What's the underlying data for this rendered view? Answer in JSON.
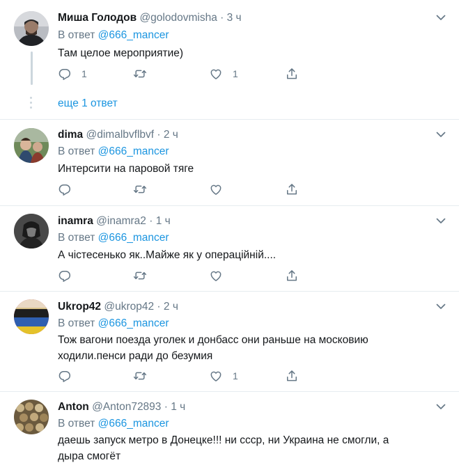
{
  "tweets": [
    {
      "name": "Миша Голодов",
      "handle": "@golodovmisha",
      "separator": "·",
      "time": "3 ч",
      "reply_prefix": "В ответ",
      "reply_mention": "@666_mancer",
      "text": "Там целое мероприятие)",
      "reply_count": "1",
      "retweet_count": "",
      "like_count": "1",
      "more_replies": "еще 1 ответ"
    },
    {
      "name": "dima",
      "handle": "@dimalbvflbvf",
      "separator": "·",
      "time": "2 ч",
      "reply_prefix": "В ответ",
      "reply_mention": "@666_mancer",
      "text": "Интерсити на паровой тяге",
      "reply_count": "",
      "retweet_count": "",
      "like_count": ""
    },
    {
      "name": "inamra",
      "handle": "@inamra2",
      "separator": "·",
      "time": "1 ч",
      "reply_prefix": "В ответ",
      "reply_mention": "@666_mancer",
      "text": "А чістесенько як..Майже як у операційній....",
      "reply_count": "",
      "retweet_count": "",
      "like_count": ""
    },
    {
      "name": "Ukrop42",
      "handle": "@ukrop42",
      "separator": "·",
      "time": "2 ч",
      "reply_prefix": "В ответ",
      "reply_mention": "@666_mancer",
      "text": "Тож вагони поезда уголек и донбасс они раньше на московию ходили.пенси ради до безумия",
      "reply_count": "",
      "retweet_count": "",
      "like_count": "1"
    },
    {
      "name": "Anton",
      "handle": "@Anton72893",
      "separator": "·",
      "time": "1 ч",
      "reply_prefix": "В ответ",
      "reply_mention": "@666_mancer",
      "text": "даешь запуск метро в Донецке!!! ни ссср, ни Украина не смогли, а дыра смогёт"
    }
  ],
  "icons": {
    "reply": "reply-icon",
    "retweet": "retweet-icon",
    "like": "like-icon",
    "share": "share-icon",
    "menu": "chevron-down-icon"
  },
  "colors": {
    "link": "#1b95e0",
    "secondary_text": "#657786",
    "divider": "#e6ecf0"
  }
}
